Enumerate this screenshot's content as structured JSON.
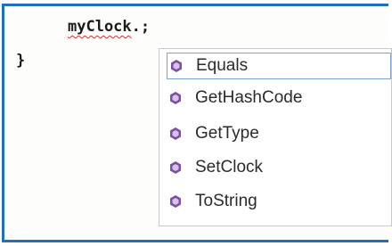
{
  "editor": {
    "line1": {
      "identifier": "myClock",
      "rest": ".;"
    },
    "line2": "}"
  },
  "intellisense": {
    "icon": "method-icon",
    "icon_color": "#7a4fa0",
    "selected_index": 0,
    "items": [
      {
        "label": "Equals"
      },
      {
        "label": "GetHashCode"
      },
      {
        "label": "GetType"
      },
      {
        "label": "SetClock"
      },
      {
        "label": "ToString"
      }
    ]
  }
}
